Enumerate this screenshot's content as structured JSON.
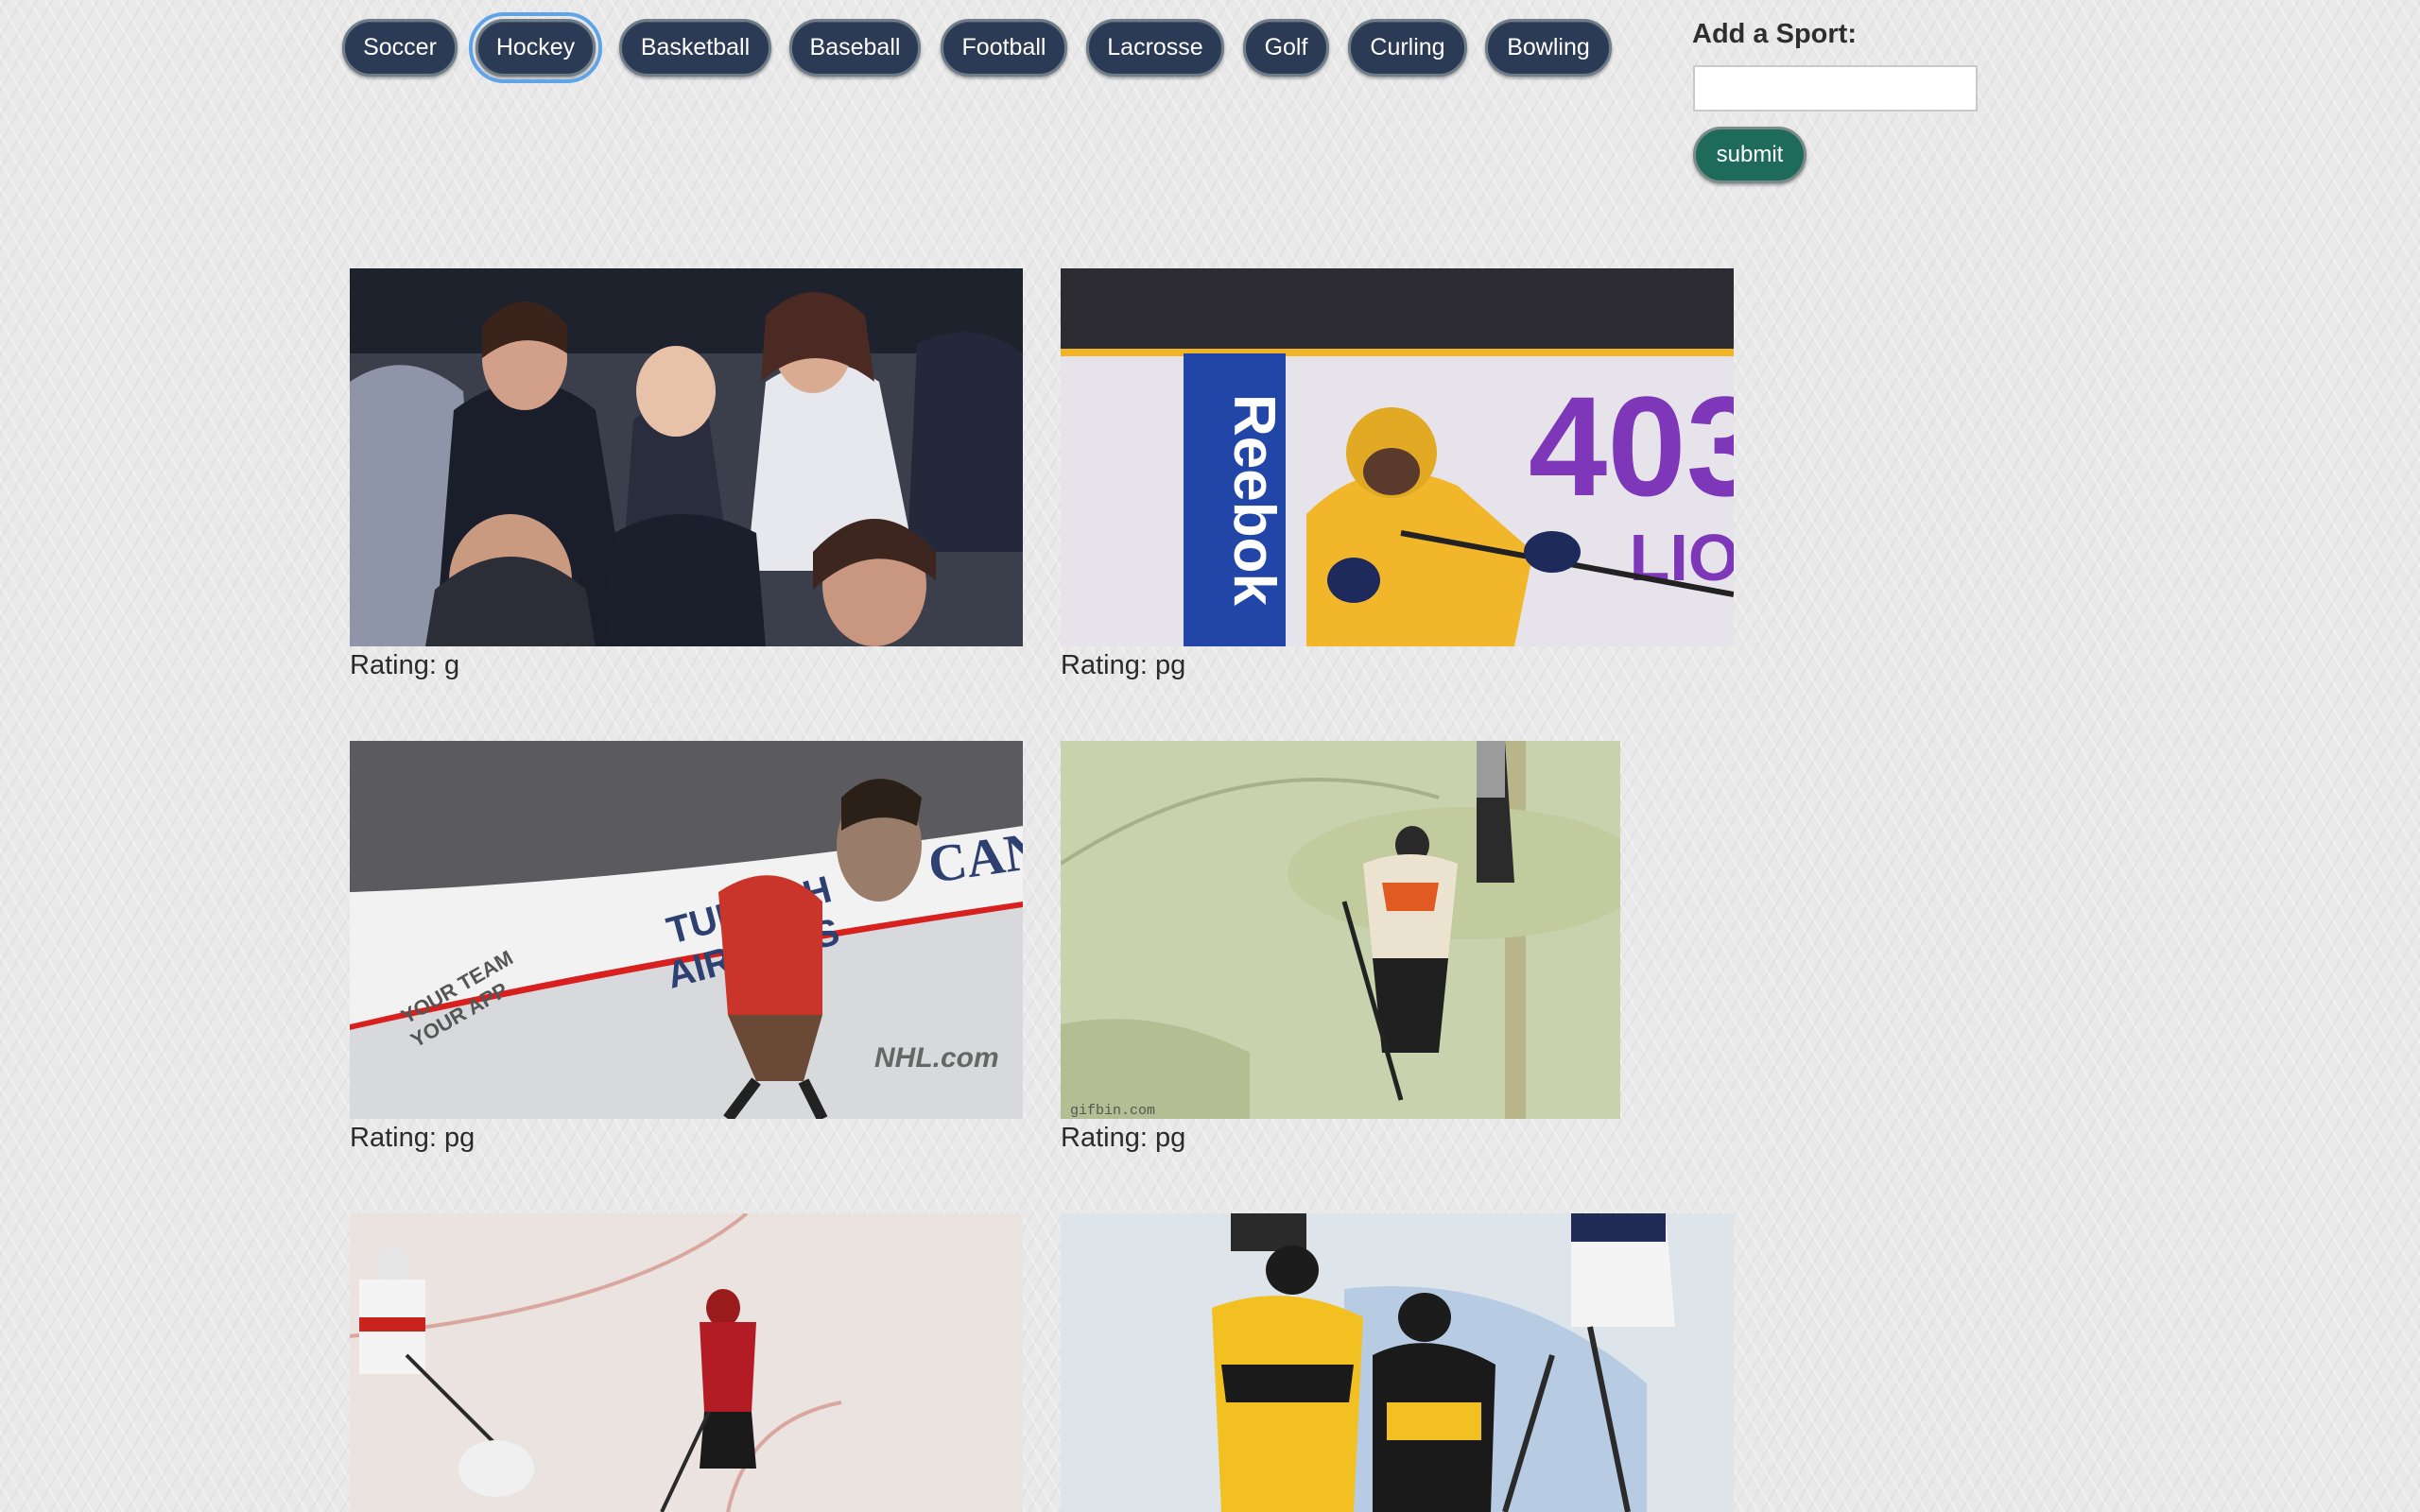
{
  "sports": [
    {
      "label": "Soccer",
      "active": false
    },
    {
      "label": "Hockey",
      "active": true
    },
    {
      "label": "Basketball",
      "active": false
    },
    {
      "label": "Baseball",
      "active": false
    },
    {
      "label": "Football",
      "active": false
    },
    {
      "label": "Lacrosse",
      "active": false
    },
    {
      "label": "Golf",
      "active": false
    },
    {
      "label": "Curling",
      "active": false
    },
    {
      "label": "Bowling",
      "active": false
    }
  ],
  "add_sport": {
    "label": "Add a Sport:",
    "input_value": "",
    "submit_label": "submit"
  },
  "gifs": [
    {
      "rating": "Rating: g",
      "scene": "crowd"
    },
    {
      "rating": "Rating: pg",
      "scene": "player-boards",
      "signage": [
        "Reebok",
        "403",
        "LIO"
      ]
    },
    {
      "rating": "Rating: pg",
      "scene": "mascot-corner",
      "signage": [
        "TURKISH",
        "AIRLINES",
        "CAN",
        "NHL.com",
        "YOUR TEAM",
        "YOUR APP"
      ]
    },
    {
      "rating": "Rating: pg",
      "scene": "ice-referee",
      "signage": [
        "gifbin.com"
      ]
    },
    {
      "rating": "",
      "scene": "ice-play"
    },
    {
      "rating": "",
      "scene": "celebration"
    }
  ],
  "colors": {
    "button_bg": "#2b3a55",
    "button_border": "#6f7d88",
    "active_outline": "#5fa3e8",
    "submit_bg": "#1f6b5b",
    "page_bg": "#e9e9e9"
  }
}
